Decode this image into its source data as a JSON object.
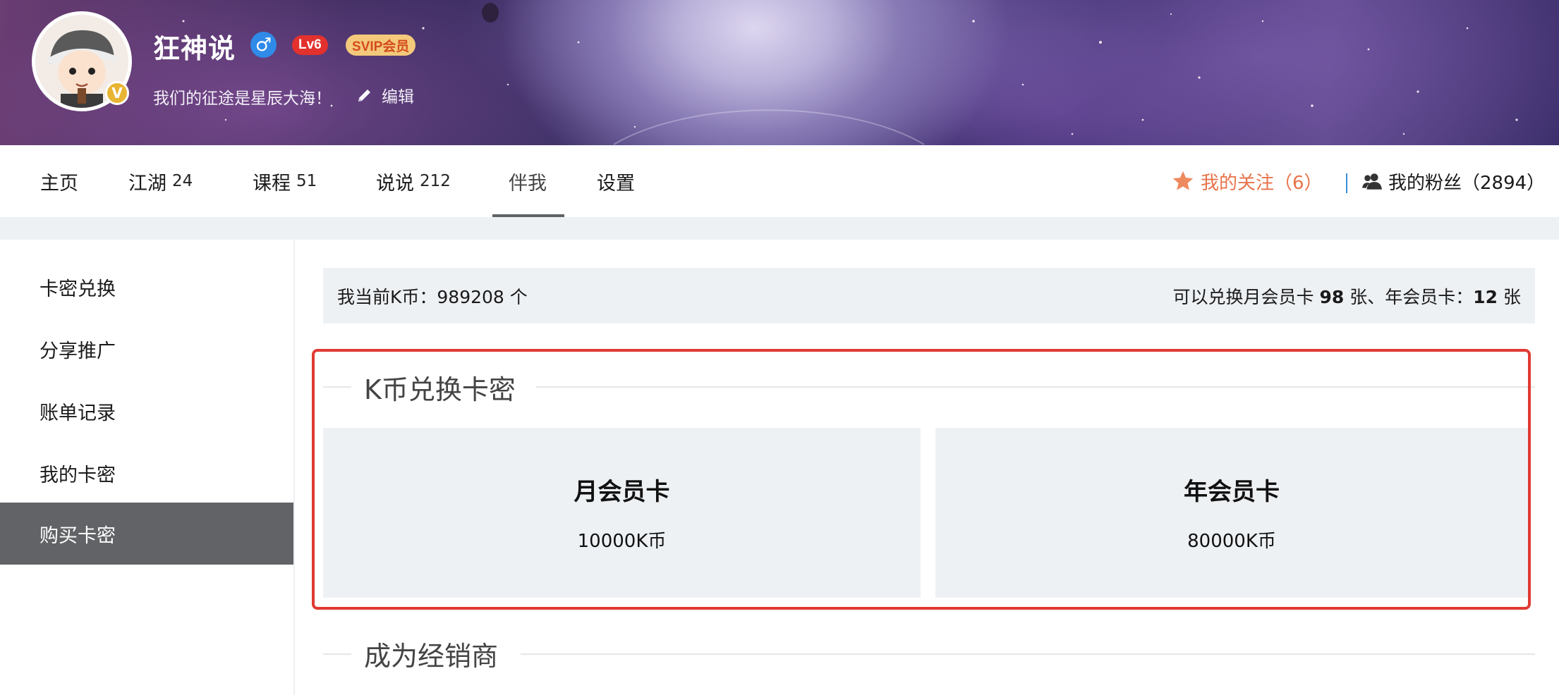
{
  "profile": {
    "username": "狂神说",
    "gender_symbol": "♂",
    "level": "Lv6",
    "vip": "SVIP会员",
    "motto": "我们的征途是星辰大海！",
    "edit_label": "编辑",
    "verified_mark": "V"
  },
  "nav": {
    "items": [
      {
        "label": "主页",
        "count": ""
      },
      {
        "label": "江湖",
        "count": "24"
      },
      {
        "label": "课程",
        "count": "51"
      },
      {
        "label": "说说",
        "count": "212"
      },
      {
        "label": "伴我",
        "count": "",
        "active": true
      },
      {
        "label": "设置",
        "count": ""
      }
    ],
    "follow_label": "我的关注（6）",
    "fans_label": "我的粉丝（2894）"
  },
  "sidebar": {
    "items": [
      {
        "label": "卡密兑换"
      },
      {
        "label": "分享推广"
      },
      {
        "label": "账单记录"
      },
      {
        "label": "我的卡密"
      },
      {
        "label": "购买卡密",
        "active": true
      }
    ]
  },
  "balance": {
    "prefix": "我当前K币：",
    "amount": "989208",
    "unit": " 个",
    "exchange_prefix": "可以兑换月会员卡 ",
    "month_count": "98",
    "exchange_mid": " 张、年会员卡：",
    "year_count": "12",
    "exchange_suffix": " 张"
  },
  "exchange_section": {
    "title": "K币兑换卡密",
    "cards": [
      {
        "name": "月会员卡",
        "price": "10000K币"
      },
      {
        "name": "年会员卡",
        "price": "80000K币"
      }
    ]
  },
  "dealer_section": {
    "title": "成为经销商"
  },
  "colors": {
    "accent_follow": "#e8734a",
    "highlight_border": "#e03a33",
    "sidebar_active": "#616366",
    "gender": "#2f8ae8",
    "level": "#e3312d"
  }
}
